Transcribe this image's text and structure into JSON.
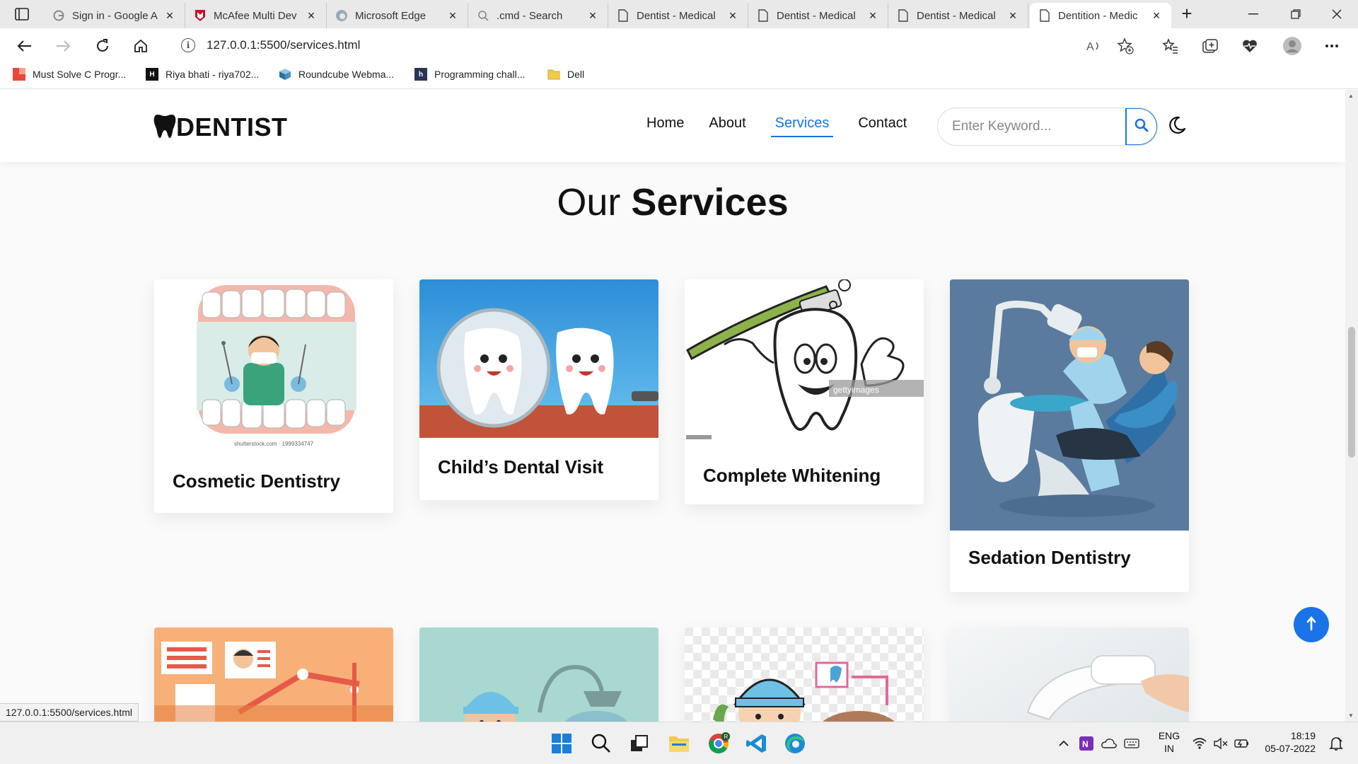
{
  "browser": {
    "tabs": [
      {
        "title": "Sign in - Google A",
        "icon": "google-icon"
      },
      {
        "title": "McAfee Multi Dev",
        "icon": "mcafee-icon"
      },
      {
        "title": "Microsoft Edge",
        "icon": "edge-icon"
      },
      {
        "title": ".cmd - Search",
        "icon": "search-icon"
      },
      {
        "title": "Dentist - Medical",
        "icon": "page-icon"
      },
      {
        "title": "Dentist - Medical",
        "icon": "page-icon"
      },
      {
        "title": "Dentist - Medical",
        "icon": "page-icon"
      },
      {
        "title": "Dentition - Medic",
        "icon": "page-icon",
        "active": true
      }
    ],
    "url": "127.0.0.1:5500/services.html",
    "bookmarks": [
      {
        "label": "Must Solve C Progr...",
        "icon": "red-grid-icon"
      },
      {
        "label": "Riya bhati - riya702...",
        "icon": "hackerrank-icon"
      },
      {
        "label": "Roundcube Webma...",
        "icon": "roundcube-icon"
      },
      {
        "label": "Programming chall...",
        "icon": "hackerearth-icon"
      },
      {
        "label": "Dell",
        "icon": "folder-icon"
      }
    ],
    "status_url": "127.0.0.1:5500/services.html"
  },
  "site": {
    "logo_text": "DENTIST",
    "nav": [
      {
        "label": "Home",
        "active": false
      },
      {
        "label": "About",
        "active": false
      },
      {
        "label": "Services",
        "active": true
      },
      {
        "label": "Contact",
        "active": false
      }
    ],
    "search_placeholder": "Enter Keyword...",
    "accent": "#1a73e8"
  },
  "section": {
    "title_light": "Our",
    "title_bold": "Services"
  },
  "cards": [
    {
      "title": "Cosmetic Dentistry",
      "image_caption": "shutterstock.com · 1999334747"
    },
    {
      "title": "Child’s Dental Visit"
    },
    {
      "title": "Complete Whitening",
      "image_caption": "gettyimages"
    },
    {
      "title": "Sedation Dentistry"
    }
  ],
  "taskbar": {
    "lang_top": "ENG",
    "lang_bottom": "IN",
    "time": "18:19",
    "date": "05-07-2022"
  }
}
